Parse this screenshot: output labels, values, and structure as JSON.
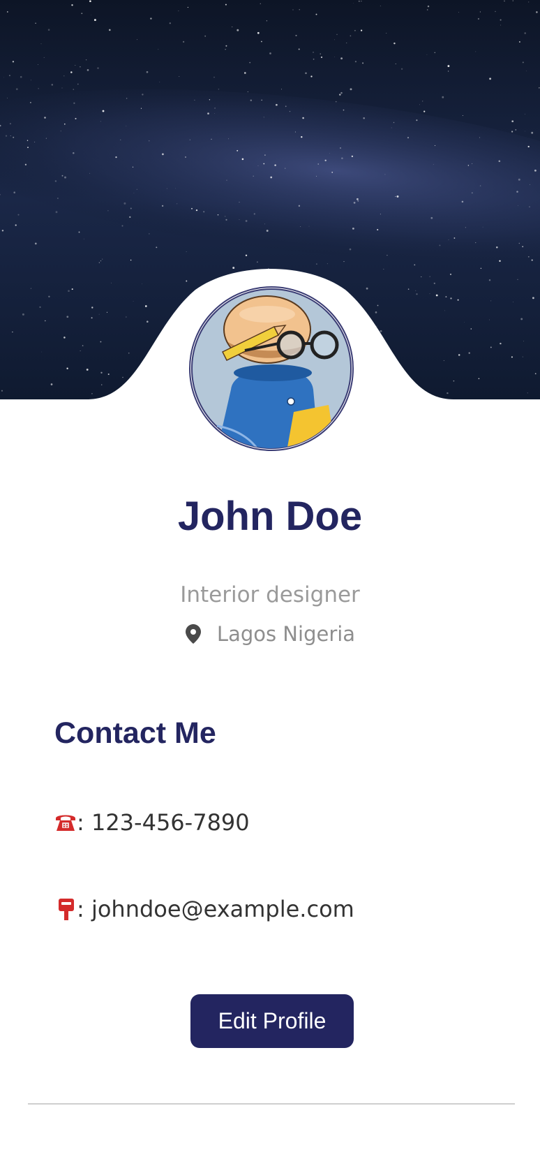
{
  "profile": {
    "name": "John Doe",
    "job_title": "Interior designer",
    "location": "Lagos Nigeria"
  },
  "contact": {
    "heading": "Contact Me",
    "phone": ": 123-456-7890",
    "email": ": johndoe@example.com"
  },
  "actions": {
    "edit_label": "Edit Profile"
  },
  "icons": {
    "hero": "starry-sky-banner",
    "avatar": "cartoon-avatar",
    "location": "map-pin-icon",
    "phone": "telephone-icon",
    "email": "postbox-icon"
  },
  "colors": {
    "accent": "#232560",
    "muted_text": "#9a9a9a",
    "body_text": "#333333"
  }
}
